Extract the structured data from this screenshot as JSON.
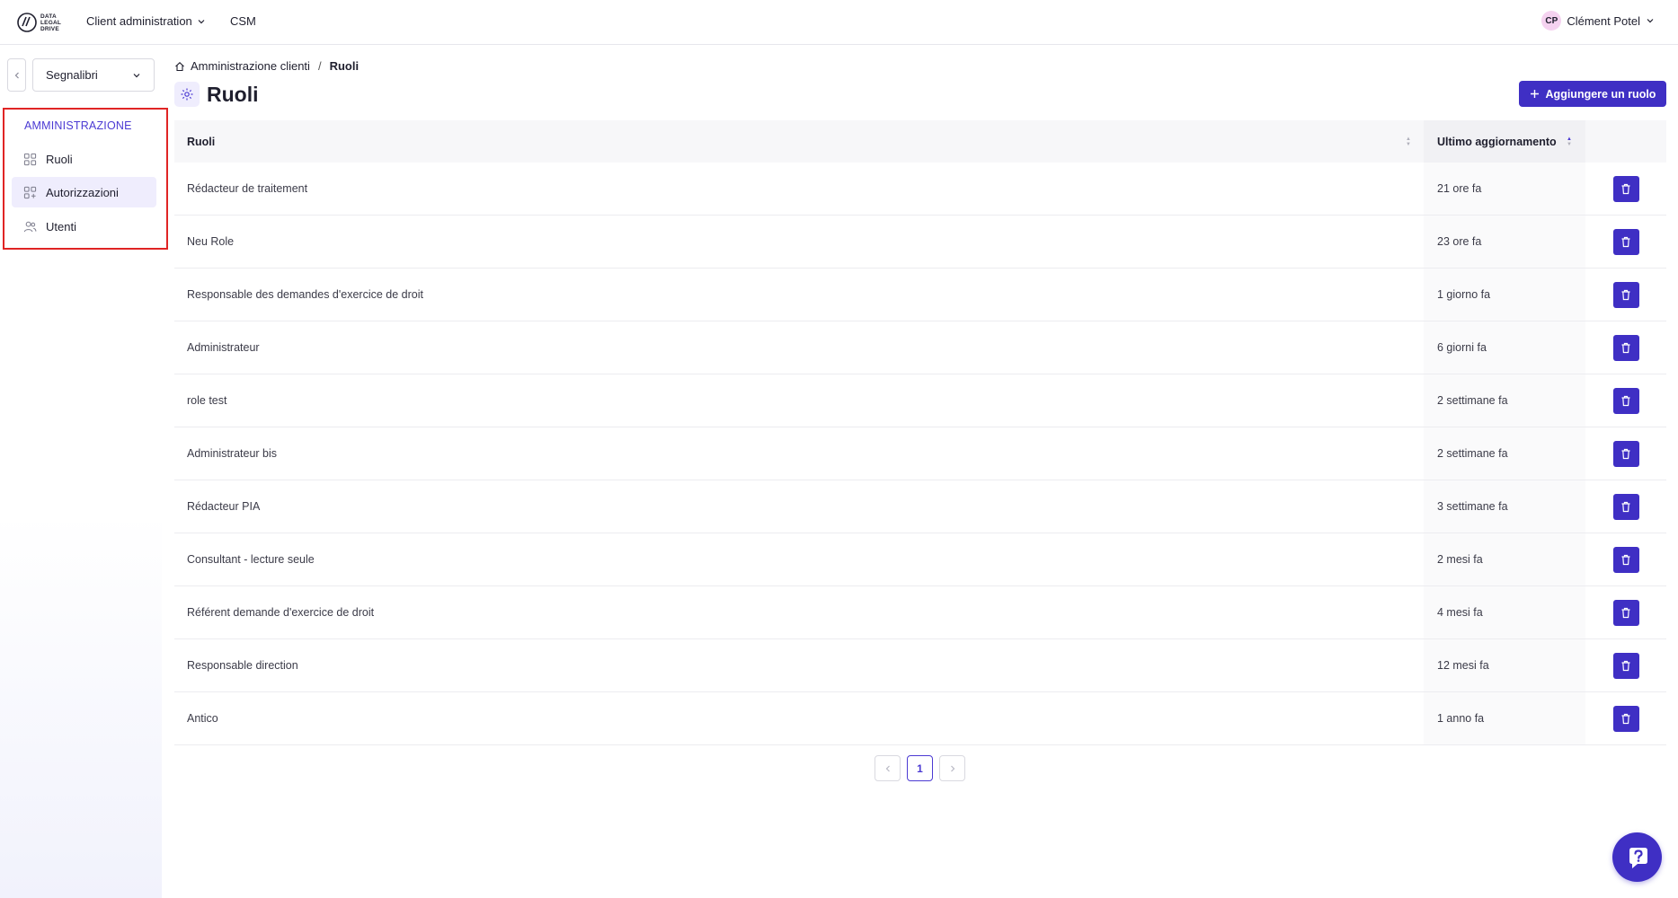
{
  "brand": {
    "logo_lines": [
      "DATA",
      "LEGAL",
      "DRIVE"
    ]
  },
  "topnav": {
    "client_admin": "Client administration",
    "csm": "CSM",
    "user_initials": "CP",
    "user_name": "Clément Potel"
  },
  "sidebar": {
    "bookmarks_label": "Segnalibri",
    "section_title": "AMMINISTRAZIONE",
    "items": [
      {
        "label": "Ruoli",
        "icon": "grid-icon",
        "active": false
      },
      {
        "label": "Autorizzazioni",
        "icon": "grid-plus-icon",
        "active": true
      },
      {
        "label": "Utenti",
        "icon": "users-icon",
        "active": false
      }
    ]
  },
  "breadcrumb": {
    "root": "Amministrazione clienti",
    "separator": "/",
    "current": "Ruoli"
  },
  "page": {
    "title": "Ruoli",
    "add_button": "Aggiungere un ruolo"
  },
  "table": {
    "columns": {
      "role": "Ruoli",
      "updated": "Ultimo aggiornamento"
    },
    "rows": [
      {
        "role": "Rédacteur de traitement",
        "updated": "21 ore fa"
      },
      {
        "role": "Neu Role",
        "updated": "23 ore fa"
      },
      {
        "role": "Responsable des demandes d'exercice de droit",
        "updated": "1 giorno fa"
      },
      {
        "role": "Administrateur",
        "updated": "6 giorni fa"
      },
      {
        "role": "role test",
        "updated": "2 settimane fa"
      },
      {
        "role": "Administrateur bis",
        "updated": "2 settimane fa"
      },
      {
        "role": "Rédacteur PIA",
        "updated": "3 settimane fa"
      },
      {
        "role": "Consultant - lecture seule",
        "updated": "2 mesi fa"
      },
      {
        "role": "Référent demande d'exercice de droit",
        "updated": "4 mesi fa"
      },
      {
        "role": "Responsable direction",
        "updated": "12 mesi fa"
      },
      {
        "role": "Antico",
        "updated": "1 anno fa"
      }
    ]
  },
  "pagination": {
    "current": "1"
  },
  "colors": {
    "accent": "#3f2fc4",
    "highlight_box": "#e02424"
  }
}
